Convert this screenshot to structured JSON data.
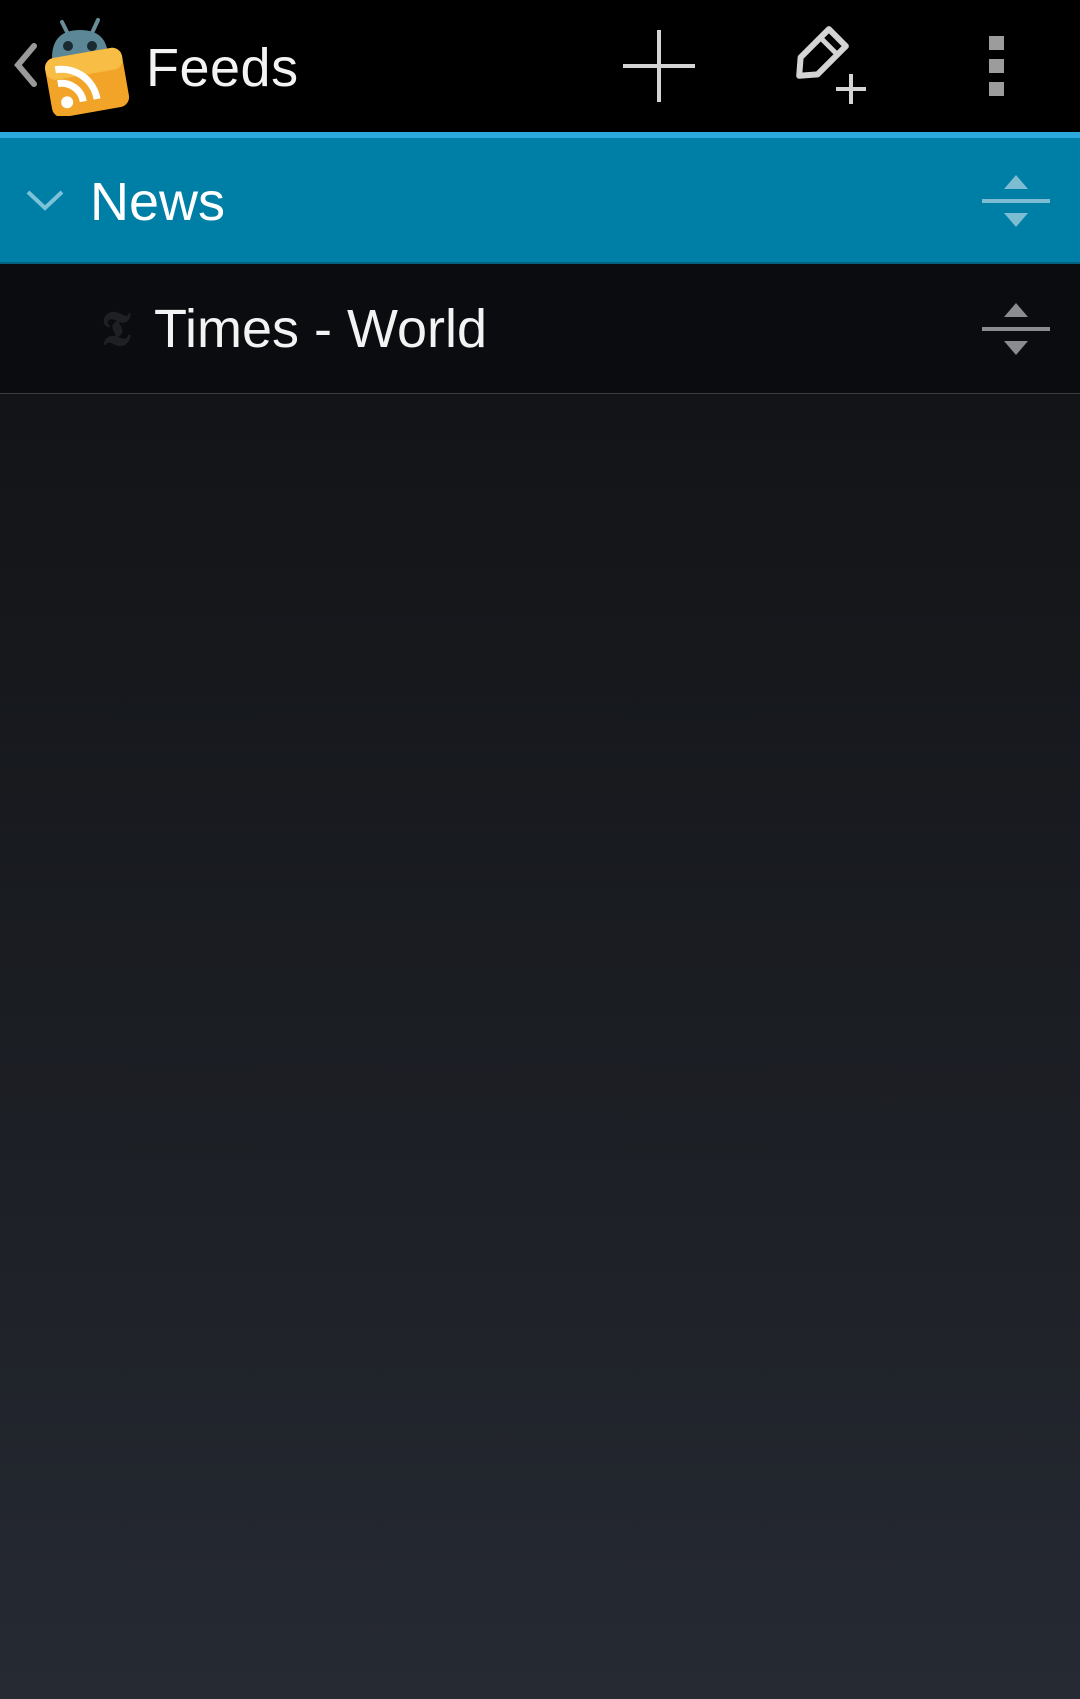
{
  "app": {
    "title": "Feeds"
  },
  "toolbar": {
    "add_label": "Add feed",
    "add_category_label": "Add category",
    "overflow_label": "More options"
  },
  "categories": [
    {
      "label": "News",
      "expanded": true,
      "feeds": [
        {
          "label": "Times - World",
          "favicon_glyph": "𝕿"
        }
      ]
    }
  ],
  "icons": {
    "up": "chevron-left-icon",
    "logo": "rss-android-logo",
    "add": "plus-icon",
    "add_category": "pencil-plus-icon",
    "overflow": "overflow-menu-icon",
    "expand": "chevron-down-icon",
    "drag": "drag-handle-icon"
  },
  "colors": {
    "action_bar": "#000000",
    "accent_line": "#2ba8dc",
    "category_background": "#007fa6",
    "text": "#f3f3f3"
  }
}
